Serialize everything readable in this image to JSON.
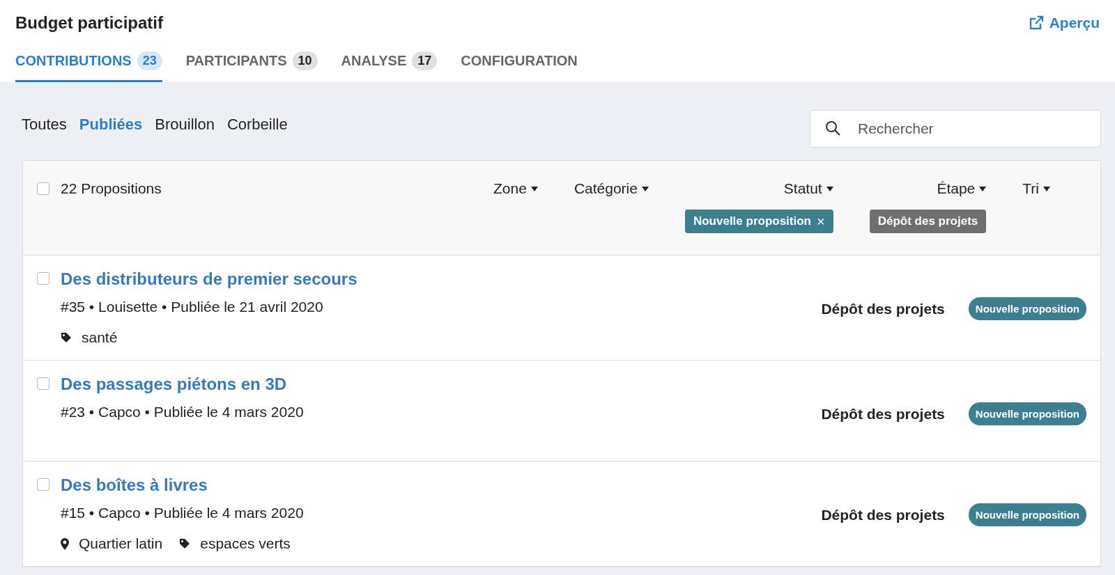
{
  "header": {
    "title": "Budget participatif",
    "preview_link": "Aperçu"
  },
  "tabs": [
    {
      "label": "CONTRIBUTIONS",
      "count": "23",
      "selected": true
    },
    {
      "label": "PARTICIPANTS",
      "count": "10",
      "selected": false
    },
    {
      "label": "ANALYSE",
      "count": "17",
      "selected": false
    },
    {
      "label": "CONFIGURATION",
      "selected": false
    }
  ],
  "state_filters": [
    {
      "label": "Toutes",
      "selected": false
    },
    {
      "label": "Publiées",
      "selected": true
    },
    {
      "label": "Brouillon",
      "selected": false
    },
    {
      "label": "Corbeille",
      "selected": false
    }
  ],
  "search": {
    "placeholder": "Rechercher"
  },
  "list": {
    "select_all": {
      "checked": false
    },
    "count_label": "22 Propositions",
    "filters": [
      {
        "label": "Zone"
      },
      {
        "label": "Catégorie"
      },
      {
        "label": "Statut",
        "chip": {
          "label": "Nouvelle proposition",
          "kind": "removable",
          "close": "×"
        }
      },
      {
        "label": "Étape",
        "chip": {
          "label": "Dépôt des projets",
          "kind": "plain"
        }
      },
      {
        "label": "Tri"
      }
    ],
    "rows": [
      {
        "checked": false,
        "title": "Des distributeurs de premier secours",
        "meta": "#35 • Louisette • Publiée le 21 avril 2020",
        "step": "Dépôt des projets",
        "status": "Nouvelle proposition",
        "tags": [
          {
            "kind": "category",
            "label": "santé"
          }
        ]
      },
      {
        "checked": false,
        "title": "Des passages piétons en 3D",
        "meta": "#23 • Capco • Publiée le 4 mars 2020",
        "step": "Dépôt des projets",
        "status": "Nouvelle proposition",
        "tags": []
      },
      {
        "checked": false,
        "title": "Des boîtes à livres",
        "meta": "#15 • Capco • Publiée le 4 mars 2020",
        "step": "Dépôt des projets",
        "status": "Nouvelle proposition",
        "tags": [
          {
            "kind": "location",
            "label": "Quartier latin"
          },
          {
            "kind": "category",
            "label": "espaces verts"
          }
        ]
      }
    ]
  }
}
